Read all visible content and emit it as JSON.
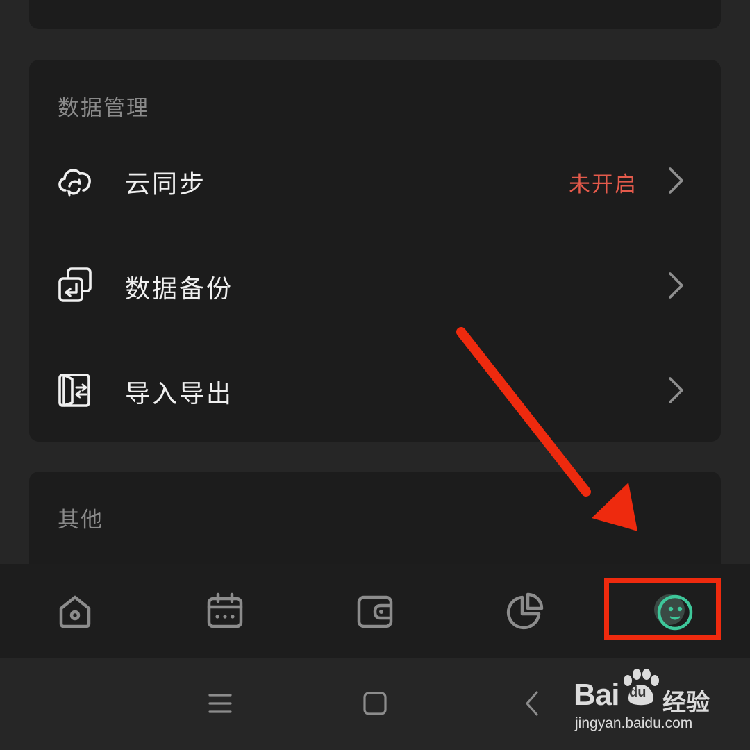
{
  "sections": {
    "data_management": {
      "title": "数据管理",
      "items": [
        {
          "label": "云同步",
          "status": "未开启",
          "icon": "cloud-sync-icon"
        },
        {
          "label": "数据备份",
          "icon": "backup-icon"
        },
        {
          "label": "导入导出",
          "icon": "import-export-icon"
        }
      ]
    },
    "other": {
      "title": "其他"
    }
  },
  "tabbar": {
    "tabs": [
      {
        "icon": "home-icon",
        "active": false
      },
      {
        "icon": "calendar-icon",
        "active": false
      },
      {
        "icon": "wallet-icon",
        "active": false
      },
      {
        "icon": "pie-chart-icon",
        "active": false
      },
      {
        "icon": "profile-face-icon",
        "active": true
      }
    ],
    "active_color": "#3ec79a",
    "inactive_color": "#8c8c8c"
  },
  "system_nav": [
    "menu-icon",
    "home-square-icon",
    "back-icon"
  ],
  "annotation": {
    "color": "#ee2a0e"
  },
  "watermark": {
    "brand_left": "Bai",
    "brand_du": "du",
    "brand_right": "经验",
    "url": "jingyan.baidu.com"
  },
  "colors": {
    "background": "#262626",
    "card": "#1c1c1c",
    "status_red": "#e45a4b"
  }
}
